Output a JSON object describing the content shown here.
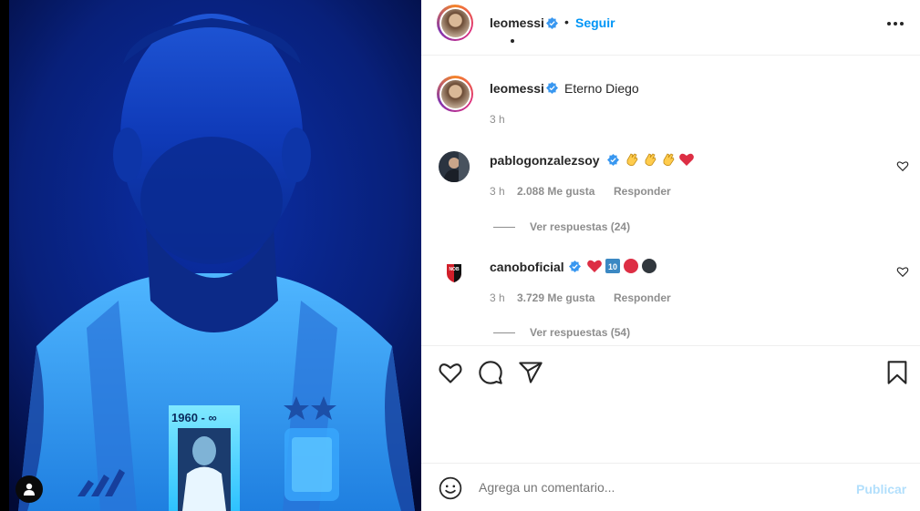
{
  "post": {
    "author": "leomessi",
    "follow_label": "Seguir",
    "separator": "•",
    "caption": "Eterno Diego",
    "caption_time": "3 h",
    "media_shirt_text": "1960 - ∞"
  },
  "comments": [
    {
      "username": "pablogonzalezsoy",
      "emojis": [
        "clap",
        "clap",
        "clap",
        "heart"
      ],
      "time": "3 h",
      "likes": "2.088 Me gusta",
      "reply_label": "Responder",
      "view_replies": "Ver respuestas (24)"
    },
    {
      "username": "canoboficial",
      "emojis": [
        "heart",
        "keycap-10",
        "red-circle",
        "black-circle"
      ],
      "time": "3 h",
      "likes": "3.729 Me gusta",
      "reply_label": "Responder",
      "view_replies": "Ver respuestas (54)"
    }
  ],
  "comment_box": {
    "placeholder": "Agrega un comentario...",
    "publish_label": "Publicar"
  },
  "colors": {
    "accent": "#0095f6",
    "verified": "#3897f0",
    "heart_red": "#ed4956",
    "muted": "#8e8e8e"
  }
}
